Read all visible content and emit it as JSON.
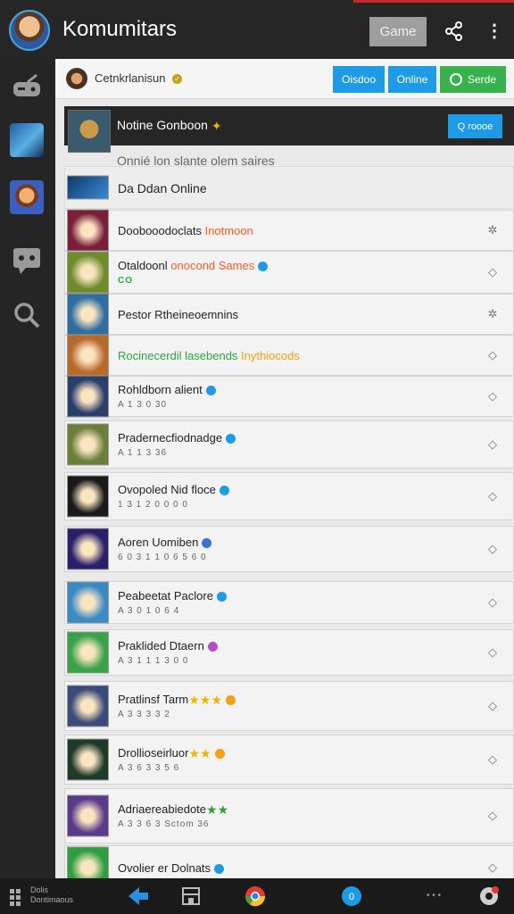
{
  "header": {
    "title": "Komumitars",
    "game_button": "Game",
    "icons": {
      "avatar": "avatar",
      "share": "share-icon",
      "more": "more-vertical-icon"
    }
  },
  "sidebar": {
    "items": [
      {
        "name": "sidebar-gamepad-icon",
        "color": "#8a8a8a"
      },
      {
        "name": "sidebar-game-art",
        "color": "#1e6fb0"
      },
      {
        "name": "sidebar-character-art",
        "color": "#c47a2c"
      },
      {
        "name": "sidebar-chat-icon",
        "color": "#8a8a8a"
      },
      {
        "name": "sidebar-search-icon",
        "color": "#8a8a8a"
      }
    ]
  },
  "main": {
    "header_strip": {
      "name": "Cetnkrlanisun",
      "buttons": [
        "Oisdoo",
        "Online",
        "Serde"
      ]
    },
    "featured": {
      "title": "Notine Gonboon",
      "button": "Q roooe",
      "subline": "Onnié lon slante olem saires"
    },
    "section_title": "Da Ddan Online",
    "rows": [
      {
        "title_a": "Doobooodoclats",
        "title_b": " Inotmoon",
        "sub": "",
        "style": "orange",
        "thumb": "#7a1e3a"
      },
      {
        "title_a": "Otaldoonl",
        "title_b": " onocond Sames",
        "sub": "CO",
        "style": "orange",
        "thumb": "#6f8c2a"
      },
      {
        "title_a": "Pestor Rtheineoemnins",
        "title_b": "",
        "sub": "",
        "style": "",
        "thumb": "#2f6ea1"
      },
      {
        "title_a": "Rocinecerdil",
        "title_b": " lasebends",
        "title_c": " Inythiocods",
        "sub": "",
        "style": "green",
        "thumb": "#b86a2a"
      },
      {
        "title_a": "Rohldborn alient",
        "title_b": "",
        "sub": "A 1 3 0 30",
        "style": "",
        "thumb": "#2a3e6a"
      },
      {
        "title_a": "Pradernecfiodnadge",
        "title_b": "",
        "sub": "A 1 1 3 36",
        "style": "",
        "thumb": "#6b7f3a"
      },
      {
        "title_a": "Ovopoled Nid floce",
        "title_b": "",
        "sub": "1 3 1 2 0 0 0 0",
        "style": "",
        "thumb": "#1a1a1a"
      },
      {
        "title_a": "Aoren Uomiben",
        "title_b": "",
        "sub": "6 0 3 1 1 0 6 5 6 0",
        "style": "",
        "thumb": "#2a1f6a"
      },
      {
        "title_a": "Peabeetat Paclore",
        "title_b": "",
        "sub": "A 3 0 1 0 6 4",
        "style": "",
        "thumb": "#3a8ac4"
      },
      {
        "title_a": "Praklided Dtaern",
        "title_b": "",
        "sub": "A 3 1 1 1 3 0 0",
        "style": "",
        "thumb": "#3aa34a"
      },
      {
        "title_a": "Pratlinsf Tarm",
        "title_b": "",
        "sub": "A 3 3 3 3 2",
        "style": "",
        "thumb": "#3a4a7a"
      },
      {
        "title_a": "Drollioseirluor",
        "title_b": "",
        "sub": "A 3 6 3 3 5 6",
        "style": "",
        "thumb": "#1f3a2a"
      },
      {
        "title_a": "Adriaereabiedote",
        "title_b": "",
        "sub": "A 3 3 6 3 Sctom 36",
        "style": "",
        "thumb": "#5a3a8a"
      },
      {
        "title_a": "Ovolier er Dolnats",
        "title_b": "",
        "sub": "",
        "style": "",
        "thumb": "#2e9e3e"
      }
    ]
  },
  "bottombar": {
    "label_line1": "Dolis",
    "label_line2": "Dontimaous",
    "icons": [
      "grid-icon",
      "back-arrow-icon",
      "store-icon",
      "chrome-icon",
      "chat-bubble-icon",
      "dots-icon",
      "settings-icon"
    ]
  }
}
